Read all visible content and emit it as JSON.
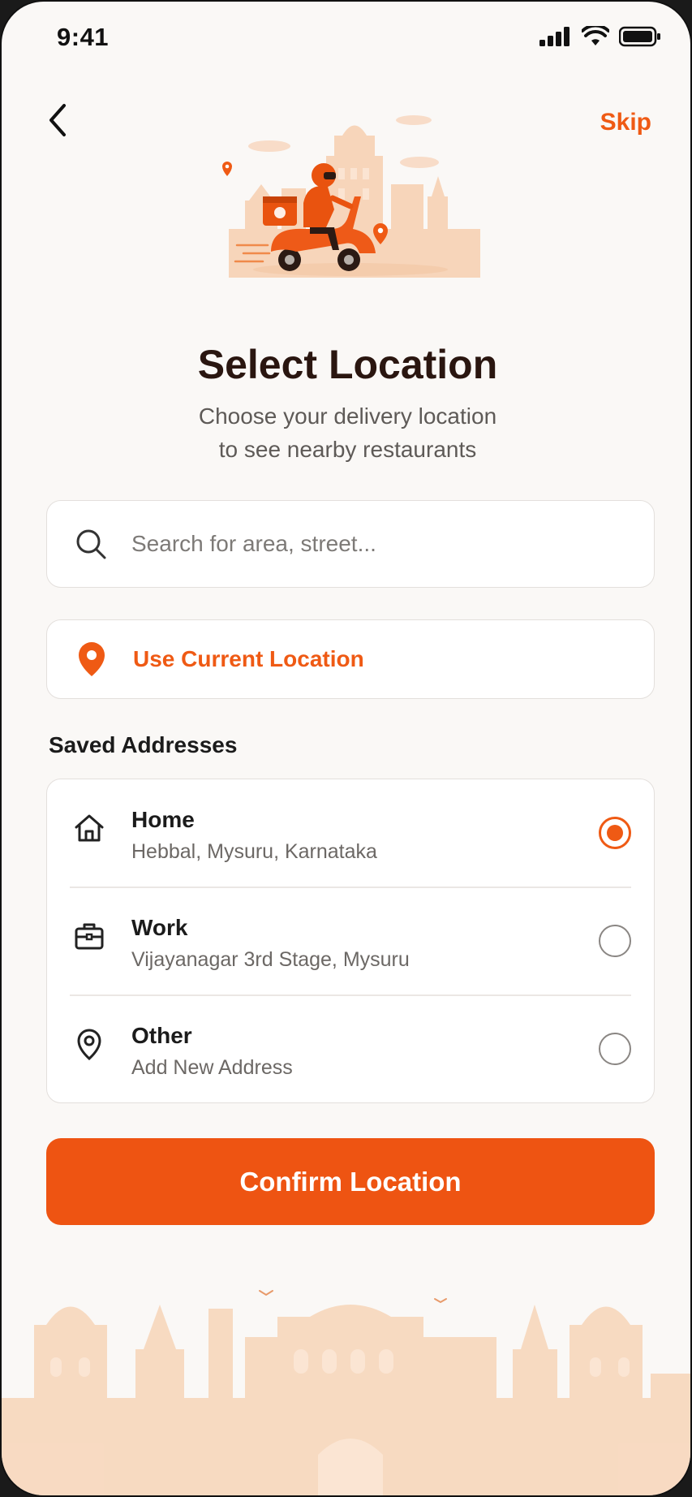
{
  "status_bar": {
    "time": "9:41"
  },
  "nav": {
    "skip_label": "Skip"
  },
  "header": {
    "title": "Select Location",
    "subtitle_line1": "Choose your delivery location",
    "subtitle_line2": "to see nearby restaurants"
  },
  "search": {
    "placeholder": "Search for area, street...",
    "value": ""
  },
  "current_location": {
    "label": "Use Current Location"
  },
  "saved": {
    "section_title": "Saved Addresses",
    "items": [
      {
        "name": "Home",
        "detail": "Hebbal, Mysuru, Karnataka",
        "icon": "home-icon",
        "selected": true
      },
      {
        "name": "Work",
        "detail": "Vijayanagar 3rd Stage, Mysuru",
        "icon": "briefcase-icon",
        "selected": false
      },
      {
        "name": "Other",
        "detail": "Add New Address",
        "icon": "location-pin-icon",
        "selected": false
      }
    ]
  },
  "confirm": {
    "label": "Confirm Location"
  },
  "colors": {
    "accent": "#ef5a14",
    "background": "#faf8f6",
    "title": "#2a1610"
  }
}
